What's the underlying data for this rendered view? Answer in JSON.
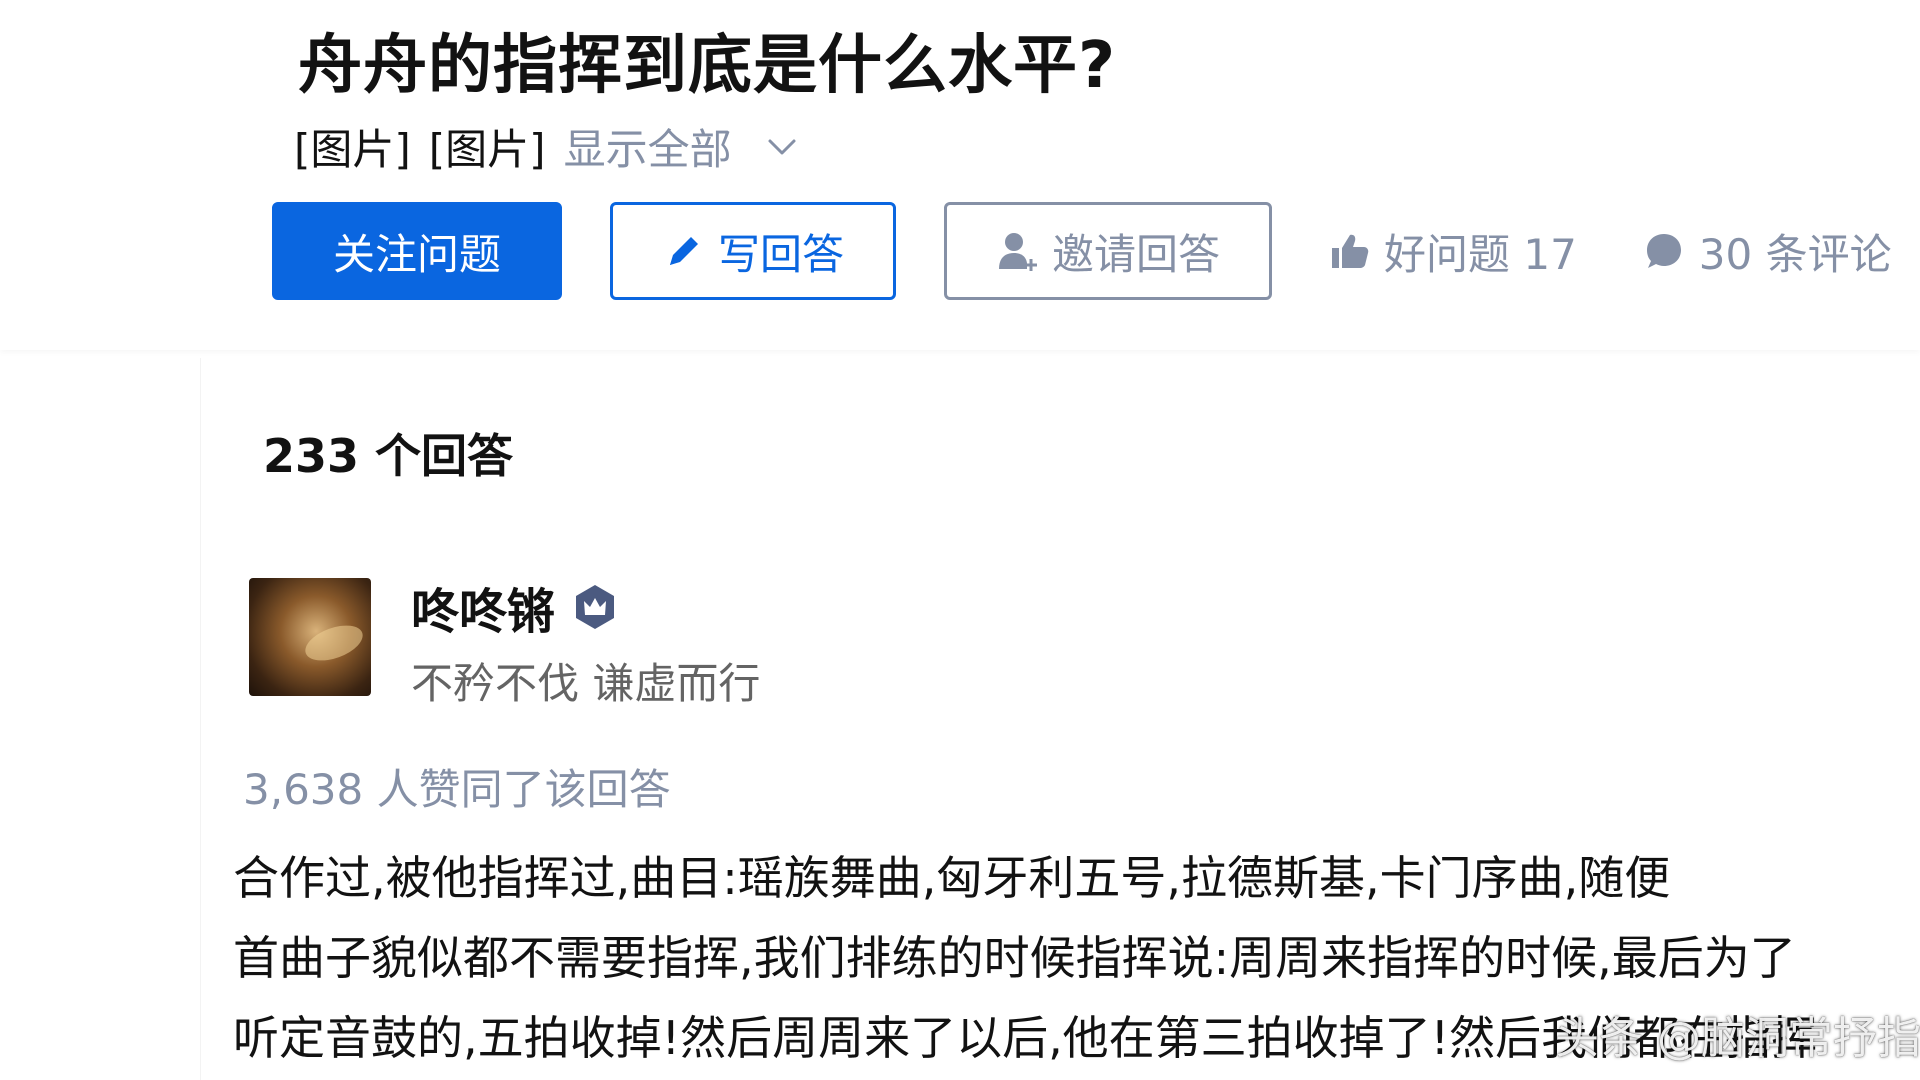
{
  "question": {
    "title": "舟舟的指挥到底是什么水平?",
    "desc_images": [
      "[图片]",
      "[图片]"
    ],
    "show_all": "显示全部",
    "actions": {
      "follow": "关注问题",
      "write": "写回答",
      "invite": "邀请回答",
      "good_question": "好问题 17",
      "comments": "30 条评论"
    }
  },
  "answers": {
    "count_label": "233 个回答",
    "first": {
      "author_name": "咚咚锵",
      "author_bio": "不矜不伐 谦虚而行",
      "votes_text": "3,638 人赞同了该回答",
      "lines": [
        "合作过,被他指挥过,曲目:瑶族舞曲,匈牙利五号,拉德斯基,卡门序曲,随便",
        "首曲子貌似都不需要指挥,我们排练的时候指挥说:周周来指挥的时候,最后为了",
        "听定音鼓的,五拍收掉!然后周周来了以后,他在第三拍收掉了!然后我们都在指挥"
      ]
    }
  },
  "watermark": "头条 @脑洞常抒指",
  "colors": {
    "primary": "#0a66e0",
    "muted": "#8590a6",
    "text": "#121212"
  },
  "icons": [
    "chevron-down-icon",
    "pencil-icon",
    "invite-user-icon",
    "thumbs-up-icon",
    "comment-bubble-icon",
    "crown-badge-icon"
  ]
}
